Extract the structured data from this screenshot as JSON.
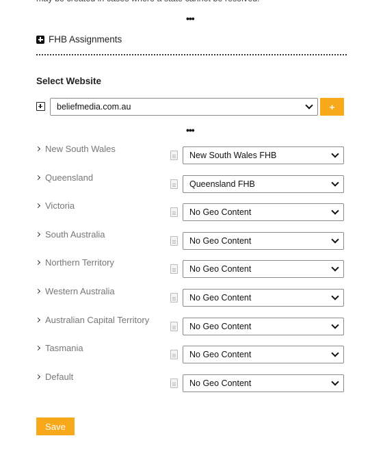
{
  "intro_text": "may be created in cases where a state cannot be resolved.",
  "ellipsis": "•••",
  "section": {
    "title": "FHB Assignments",
    "icon": "plus-square-filled-icon"
  },
  "website": {
    "label": "Select Website",
    "selected": "beliefmedia.com.au",
    "add_label": "+",
    "expand_icon": "plus-square-outline-icon"
  },
  "states": [
    {
      "label": "New South Wales",
      "selected": "New South Wales FHB"
    },
    {
      "label": "Queensland",
      "selected": "Queensland FHB"
    },
    {
      "label": "Victoria",
      "selected": "No Geo Content"
    },
    {
      "label": "South Australia",
      "selected": "No Geo Content"
    },
    {
      "label": "Northern Territory",
      "selected": "No Geo Content"
    },
    {
      "label": "Western Australia",
      "selected": "No Geo Content"
    },
    {
      "label": "Australian Capital Territory",
      "selected": "No Geo Content"
    },
    {
      "label": "Tasmania",
      "selected": "No Geo Content"
    },
    {
      "label": "Default",
      "selected": "No Geo Content"
    }
  ],
  "save_label": "Save",
  "colors": {
    "accent": "#f7a81b",
    "label_gray": "#777777"
  }
}
